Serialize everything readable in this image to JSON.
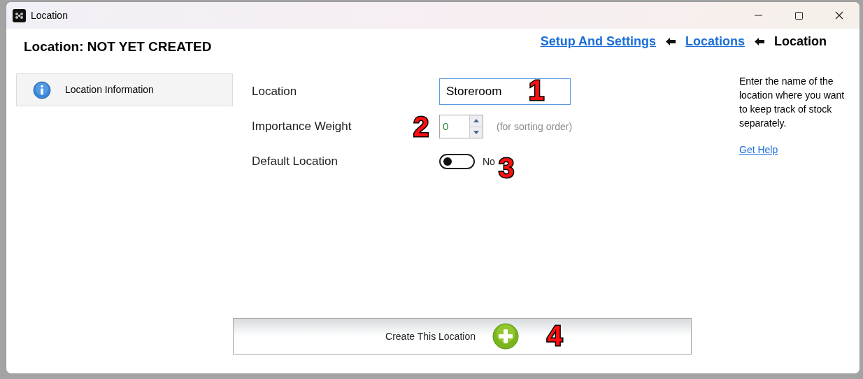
{
  "window": {
    "title": "Location"
  },
  "header": {
    "title": "Location: NOT YET CREATED"
  },
  "breadcrumbs": [
    {
      "label": "Setup And Settings",
      "kind": "link"
    },
    {
      "label": "Locations",
      "kind": "link"
    },
    {
      "label": "Location",
      "kind": "current"
    }
  ],
  "sidebar": {
    "items": [
      {
        "label": "Location Information",
        "selected": true
      }
    ]
  },
  "fields": [
    {
      "kind": "text",
      "label": "Location",
      "value": "Storeroom",
      "callout": "1"
    },
    {
      "kind": "spinner",
      "label": "Importance Weight",
      "value": "0",
      "hint": "(for sorting order)",
      "callout": "2"
    },
    {
      "kind": "toggle",
      "label": "Default Location",
      "on": false,
      "state_text": "No",
      "callout": "3"
    }
  ],
  "help": {
    "text": "Enter the name of the location where you want to keep track of stock separately.",
    "link": "Get Help"
  },
  "create_button": {
    "label": "Create This Location",
    "callout": "4"
  }
}
